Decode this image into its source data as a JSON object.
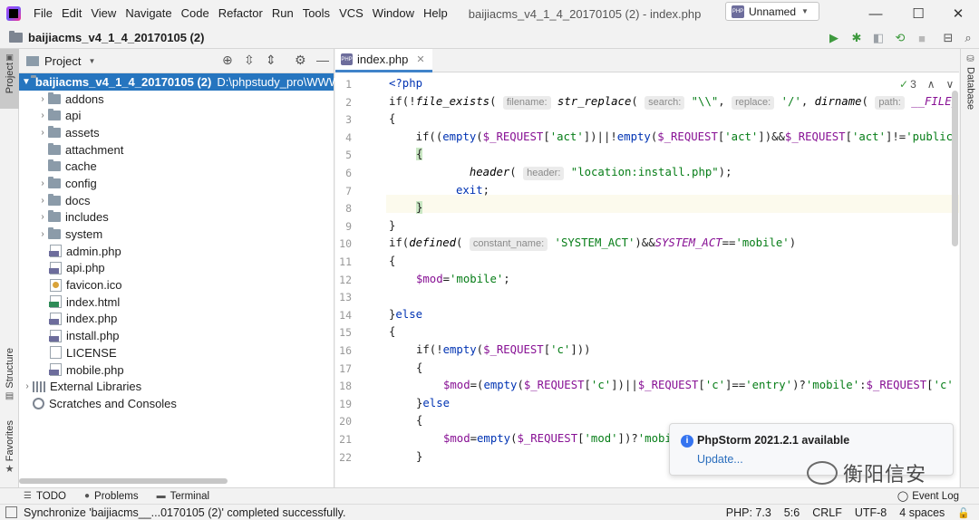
{
  "window": {
    "menu": [
      "File",
      "Edit",
      "View",
      "Navigate",
      "Code",
      "Refactor",
      "Run",
      "Tools",
      "VCS",
      "Window",
      "Help"
    ],
    "title": "baijiacms_v4_1_4_20170105 (2) - index.php",
    "minimize": "—",
    "maximize": "☐",
    "close": "✕"
  },
  "navbar": {
    "project": "baijiacms_v4_1_4_20170105 (2)",
    "run_config": "Unnamed",
    "run_config_badge": "PHP"
  },
  "side_tabs": {
    "project": "Project",
    "structure": "Structure",
    "favorites": "Favorites",
    "database": "Database"
  },
  "project_panel": {
    "title": "Project",
    "root": {
      "name": "baijiacms_v4_1_4_20170105 (2)",
      "path": "D:\\phpstudy_pro\\WWW"
    },
    "items": [
      {
        "name": "addons",
        "kind": "folder",
        "expandable": true
      },
      {
        "name": "api",
        "kind": "folder",
        "expandable": true
      },
      {
        "name": "assets",
        "kind": "folder",
        "expandable": true
      },
      {
        "name": "attachment",
        "kind": "folder",
        "expandable": false
      },
      {
        "name": "cache",
        "kind": "folder",
        "expandable": false
      },
      {
        "name": "config",
        "kind": "folder",
        "expandable": true
      },
      {
        "name": "docs",
        "kind": "folder",
        "expandable": true
      },
      {
        "name": "includes",
        "kind": "folder",
        "expandable": true
      },
      {
        "name": "system",
        "kind": "folder",
        "expandable": true
      },
      {
        "name": "admin.php",
        "kind": "php",
        "expandable": false
      },
      {
        "name": "api.php",
        "kind": "php",
        "expandable": false
      },
      {
        "name": "favicon.ico",
        "kind": "ico",
        "expandable": false
      },
      {
        "name": "index.html",
        "kind": "html",
        "expandable": false
      },
      {
        "name": "index.php",
        "kind": "php",
        "expandable": false
      },
      {
        "name": "install.php",
        "kind": "php",
        "expandable": false
      },
      {
        "name": "LICENSE",
        "kind": "text",
        "expandable": false
      },
      {
        "name": "mobile.php",
        "kind": "php",
        "expandable": false
      }
    ],
    "external_libraries": "External Libraries",
    "scratches": "Scratches and Consoles"
  },
  "editor": {
    "tab": "index.php",
    "tab_badge": "PHP",
    "inspection_count": "3",
    "line_numbers": [
      "1",
      "2",
      "3",
      "4",
      "5",
      "6",
      "7",
      "8",
      "9",
      "10",
      "11",
      "12",
      "13",
      "14",
      "15",
      "16",
      "17",
      "18",
      "19",
      "20",
      "21",
      "22"
    ],
    "code": {
      "l1": "<?php",
      "l2_a": "if(!",
      "l2_fn1": "file_exists",
      "l2_b": "( ",
      "l2_hint1": "filename:",
      "l2_fn2": " str_replace",
      "l2_c": "( ",
      "l2_hint2": "search:",
      "l2_s1": " \"\\\\\"",
      "l2_d": ", ",
      "l2_hint3": "replace:",
      "l2_s2": " '/'",
      "l2_e": ", ",
      "l2_fn3": "dirname",
      "l2_f": "( ",
      "l2_hint4": "path:",
      "l2_const": " __FILE__",
      "l2_g": "))",
      "l3": "{",
      "l4_a": "    if((",
      "l4_kw1": "empty",
      "l4_b": "(",
      "l4_v1": "$_REQUEST",
      "l4_c": "[",
      "l4_s1": "'act'",
      "l4_d": "])||!",
      "l4_kw2": "empty",
      "l4_e": "(",
      "l4_v2": "$_REQUEST",
      "l4_f": "[",
      "l4_s2": "'act'",
      "l4_g": "])&&",
      "l4_v3": "$_REQUEST",
      "l4_h": "[",
      "l4_s3": "'act'",
      "l4_i": "]!=",
      "l4_s4": "'public",
      "l5": "{",
      "l6_a": "            ",
      "l6_fn": "header",
      "l6_b": "( ",
      "l6_hint": "header:",
      "l6_s": " \"location:install.php\"",
      "l6_c": ");",
      "l7_kw": "exit",
      "l7_b": ";",
      "l8": "}",
      "l9": "}",
      "l10_a": "if(",
      "l10_fn": "defined",
      "l10_b": "( ",
      "l10_hint": "constant_name:",
      "l10_s1": " 'SYSTEM_ACT'",
      "l10_c": ")&&",
      "l10_const": "SYSTEM_ACT",
      "l10_d": "==",
      "l10_s2": "'mobile'",
      "l10_e": ")",
      "l11": "{",
      "l12_v": "$mod",
      "l12_b": "=",
      "l12_s": "'mobile'",
      "l12_c": ";",
      "l14_a": "}",
      "l14_kw": "else",
      "l15": "{",
      "l16_a": "if(!",
      "l16_kw": "empty",
      "l16_b": "(",
      "l16_v": "$_REQUEST",
      "l16_c": "[",
      "l16_s": "'c'",
      "l16_d": "]))",
      "l17": "{",
      "l18_v1": "$mod",
      "l18_a": "=(",
      "l18_kw": "empty",
      "l18_b": "(",
      "l18_v2": "$_REQUEST",
      "l18_c": "[",
      "l18_s1": "'c'",
      "l18_d": "])||",
      "l18_v3": "$_REQUEST",
      "l18_e": "[",
      "l18_s2": "'c'",
      "l18_f": "]==",
      "l18_s3": "'entry'",
      "l18_g": ")?",
      "l18_s4": "'mobile'",
      "l18_h": ":",
      "l18_v4": "$_REQUEST",
      "l18_i": "[",
      "l18_s5": "'c'",
      "l19_a": "}",
      "l19_kw": "else",
      "l20": "{",
      "l21_v1": "$mod",
      "l21_a": "=",
      "l21_kw": "empty",
      "l21_b": "(",
      "l21_v2": "$_REQUEST",
      "l21_c": "[",
      "l21_s1": "'mod'",
      "l21_d": "])?",
      "l21_s2": "'mobi",
      "l22": "}"
    }
  },
  "notification": {
    "title": "PhpStorm 2021.2.1 available",
    "link": "Update..."
  },
  "watermark": "衡阳信安",
  "tool_windows": {
    "todo": "TODO",
    "problems": "Problems",
    "terminal": "Terminal",
    "event_log": "Event Log"
  },
  "status": {
    "message": "Synchronize 'baijiacms__...0170105 (2)' completed successfully.",
    "php": "PHP: 7.3",
    "position": "5:6",
    "line_sep": "CRLF",
    "encoding": "UTF-8",
    "indent": "4 spaces"
  }
}
